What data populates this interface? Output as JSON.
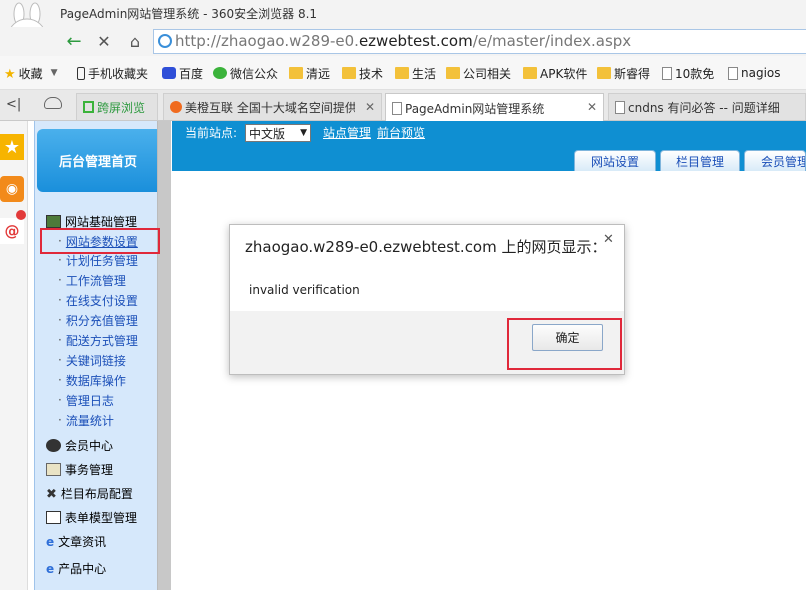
{
  "window": {
    "title": "PageAdmin网站管理系统 - 360安全浏览器 8.1"
  },
  "address": {
    "prefix": "http://zhaogao.w289-e0.",
    "domain": "ezwebtest.com",
    "path": "/e/master/index.aspx"
  },
  "bookmarks": [
    {
      "label": "收藏",
      "icon": "star-icon"
    },
    {
      "label": "手机收藏夹",
      "icon": "mobile-icon"
    },
    {
      "label": "百度",
      "icon": "baidu-icon"
    },
    {
      "label": "微信公众",
      "icon": "wechat-icon"
    },
    {
      "label": "清远",
      "icon": "folder-icon"
    },
    {
      "label": "技术",
      "icon": "folder-icon"
    },
    {
      "label": "生活",
      "icon": "folder-icon"
    },
    {
      "label": "公司相关",
      "icon": "folder-icon"
    },
    {
      "label": "APK软件",
      "icon": "folder-icon"
    },
    {
      "label": "斯睿得",
      "icon": "folder-icon"
    },
    {
      "label": "10款免",
      "icon": "page-icon"
    },
    {
      "label": "nagios",
      "icon": "page-icon"
    }
  ],
  "tabs": [
    {
      "label": "跨屏浏览"
    },
    {
      "label": "美橙互联 全国十大域名空间提供"
    },
    {
      "label": "PageAdmin网站管理系统"
    },
    {
      "label": "cndns 有问必答 -- 问题详细"
    }
  ],
  "sidebar": {
    "home": "后台管理首页",
    "group_title": "网站基础管理",
    "sub_items": [
      "网站参数设置",
      "计划任务管理",
      "工作流管理",
      "在线支付设置",
      "积分充值管理",
      "配送方式管理",
      "关键词链接",
      "数据库操作",
      "管理日志",
      "流量统计"
    ],
    "groups": [
      "会员中心",
      "事务管理",
      "栏目布局配置",
      "表单模型管理",
      "文章资讯",
      "产品中心"
    ]
  },
  "header": {
    "site_label": "当前站点:",
    "site_value": "中文版",
    "links": [
      "站点管理",
      "前台预览"
    ],
    "tabs": [
      "网站设置",
      "栏目管理",
      "会员管理"
    ]
  },
  "dialog": {
    "title": "zhaogao.w289-e0.ezwebtest.com 上的网页显示：",
    "message": "invalid verification",
    "ok": "确定"
  },
  "colors": {
    "accent": "#0f8fd2",
    "highlight": "#e0283a",
    "sidebar_bg": "#d6e8fb"
  }
}
